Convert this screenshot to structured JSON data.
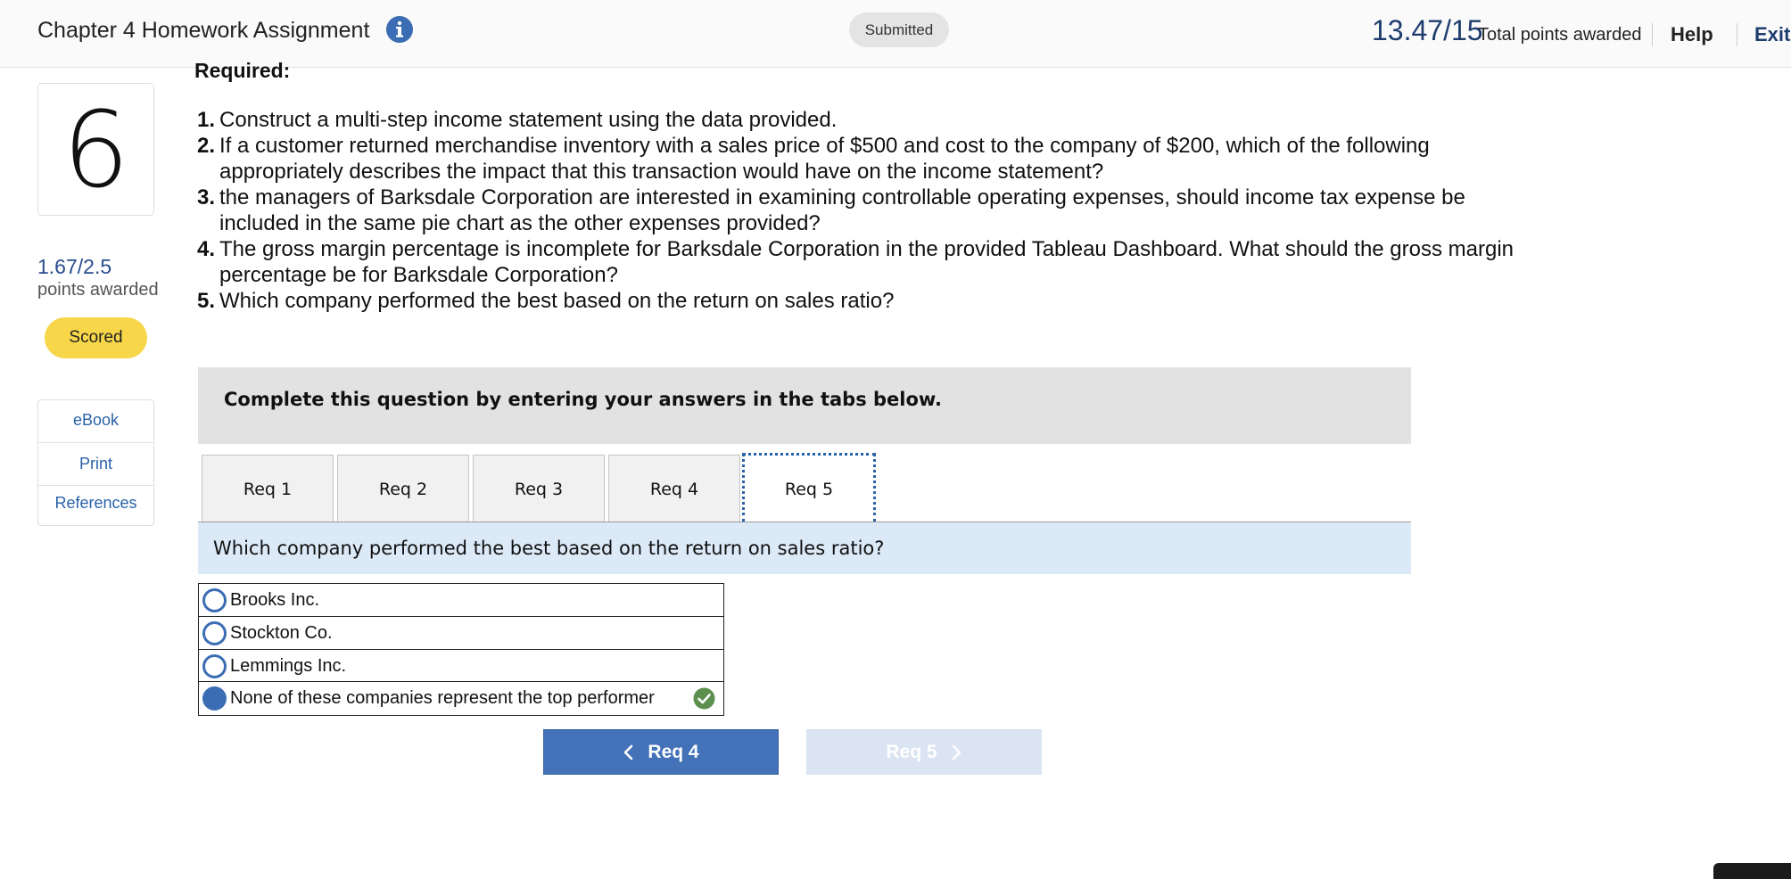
{
  "header": {
    "title": "Chapter 4 Homework Assignment",
    "status": "Submitted",
    "score": "13.47/15",
    "score_label": "Total points awarded",
    "help": "Help",
    "exit": "Exit"
  },
  "sidebar": {
    "question_number": "6",
    "points": "1.67/2.5",
    "points_label": "points awarded",
    "status_badge": "Scored",
    "links": [
      "eBook",
      "Print",
      "References"
    ]
  },
  "question": {
    "required_heading": "Required:",
    "items": [
      {
        "num": "1.",
        "text": "Construct a multi-step income statement using the data provided."
      },
      {
        "num": "2.",
        "text": "If a customer returned merchandise inventory with a sales price of $500 and cost to the company of $200, which of the following appropriately describes the impact that this transaction would have on the income statement?"
      },
      {
        "num": "3.",
        "text": "the managers of Barksdale Corporation are interested in examining controllable operating expenses, should income tax expense be included in the same pie chart as the other expenses provided?"
      },
      {
        "num": "4.",
        "text": "The gross margin percentage is incomplete for Barksdale Corporation in the provided Tableau Dashboard. What should the gross margin percentage be for Barksdale Corporation?"
      },
      {
        "num": "5.",
        "text": "Which company performed the best based on the return on sales ratio?"
      }
    ]
  },
  "instruction": "Complete this question by entering your answers in the tabs below.",
  "tabs": [
    "Req 1",
    "Req 2",
    "Req 3",
    "Req 4",
    "Req 5"
  ],
  "active_tab": "Req 5",
  "prompt": "Which company performed the best based on the return on sales ratio?",
  "options": [
    {
      "label": "Brooks Inc.",
      "selected": false
    },
    {
      "label": "Stockton Co.",
      "selected": false
    },
    {
      "label": "Lemmings Inc.",
      "selected": false
    },
    {
      "label": "None of these companies represent the top performer",
      "selected": true,
      "correct": true
    }
  ],
  "nav": {
    "prev_label": "Req 4",
    "next_label": "Req 5"
  },
  "colors": {
    "brand_blue": "#1e3d6e",
    "link_blue": "#2a62a8",
    "button_blue": "#4472b8",
    "scored_yellow": "#f7d64a",
    "correct_green": "#5d8f4f"
  }
}
